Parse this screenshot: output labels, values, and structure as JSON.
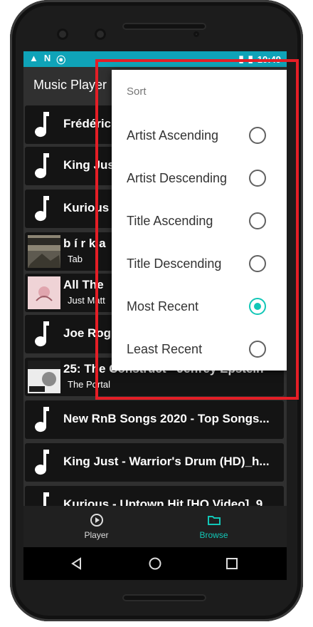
{
  "status": {
    "icons": [
      "drive-icon",
      "n-icon",
      "play-circle-icon"
    ],
    "time": "10:49"
  },
  "app": {
    "title": "Music Player"
  },
  "tracks": [
    {
      "title": "Frédéric",
      "subtitle": "",
      "thumb": "music-note-icon"
    },
    {
      "title": "King Jus",
      "subtitle": "",
      "thumb": "music-note-icon"
    },
    {
      "title": "Kurious",
      "subtitle": "",
      "thumb": "music-note-icon"
    },
    {
      "title": "b í r k a",
      "subtitle": "Tab",
      "thumb": "barka-album-art"
    },
    {
      "title": "All The",
      "subtitle": "Just Matt",
      "thumb": "album-art-pink"
    },
    {
      "title": "Joe Rog",
      "subtitle": "",
      "thumb": "music-note-icon"
    },
    {
      "title": "25: The Construct - Jeffrey Epstein",
      "subtitle": "The Portal",
      "thumb": "portal-podcast-art"
    },
    {
      "title": "New RnB Songs 2020 - Top Songs...",
      "subtitle": "",
      "thumb": "music-note-icon"
    },
    {
      "title": "King Just - Warrior's Drum (HD)_h...",
      "subtitle": "",
      "thumb": "music-note-icon"
    },
    {
      "title": "Kurious - Uptown Hit [HQ Video]_9...",
      "subtitle": "",
      "thumb": "music-note-icon"
    }
  ],
  "sort_menu": {
    "title": "Sort",
    "options": [
      {
        "label": "Artist Ascending",
        "selected": false
      },
      {
        "label": "Artist Descending",
        "selected": false
      },
      {
        "label": "Title Ascending",
        "selected": false
      },
      {
        "label": "Title Descending",
        "selected": false
      },
      {
        "label": "Most Recent",
        "selected": true
      },
      {
        "label": "Least Recent",
        "selected": false
      }
    ]
  },
  "bottom_nav": {
    "player_label": "Player",
    "browse_label": "Browse",
    "active": "Browse"
  },
  "colors": {
    "accent": "#12c7b7",
    "statusbar": "#0fa3b8",
    "annotation": "#e41e26"
  }
}
